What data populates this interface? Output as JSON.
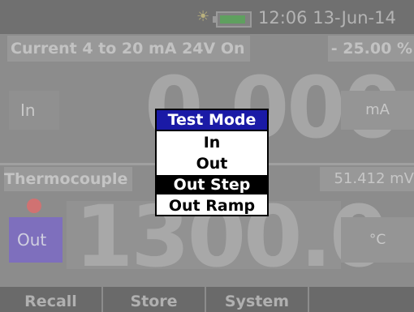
{
  "status_bar": {
    "sun_icon": "sun-icon",
    "battery_icon": "battery-icon",
    "time": "12:06",
    "date": "13-Jun-14"
  },
  "upper_display": {
    "function": "Current 4 to 20 mA 24V On",
    "percent": "- 25.00 %",
    "mode": "In",
    "value": "0.000",
    "unit": "mA"
  },
  "lower_display": {
    "function": "Thermocouple",
    "reading": "51.412 mV",
    "mode": "Out",
    "value": "1300.0",
    "unit": "°C"
  },
  "softkeys": [
    "Recall",
    "Store",
    "System",
    ""
  ],
  "test_mode_menu": {
    "title": "Test Mode",
    "items": [
      "In",
      "Out",
      "Out Step",
      "Out Ramp"
    ],
    "selected": "Out Step"
  },
  "colors": {
    "menu_title_bg": "#1a1aa6",
    "out_mode_bg": "#7e6fbd",
    "indicator_dot": "#d07272"
  }
}
